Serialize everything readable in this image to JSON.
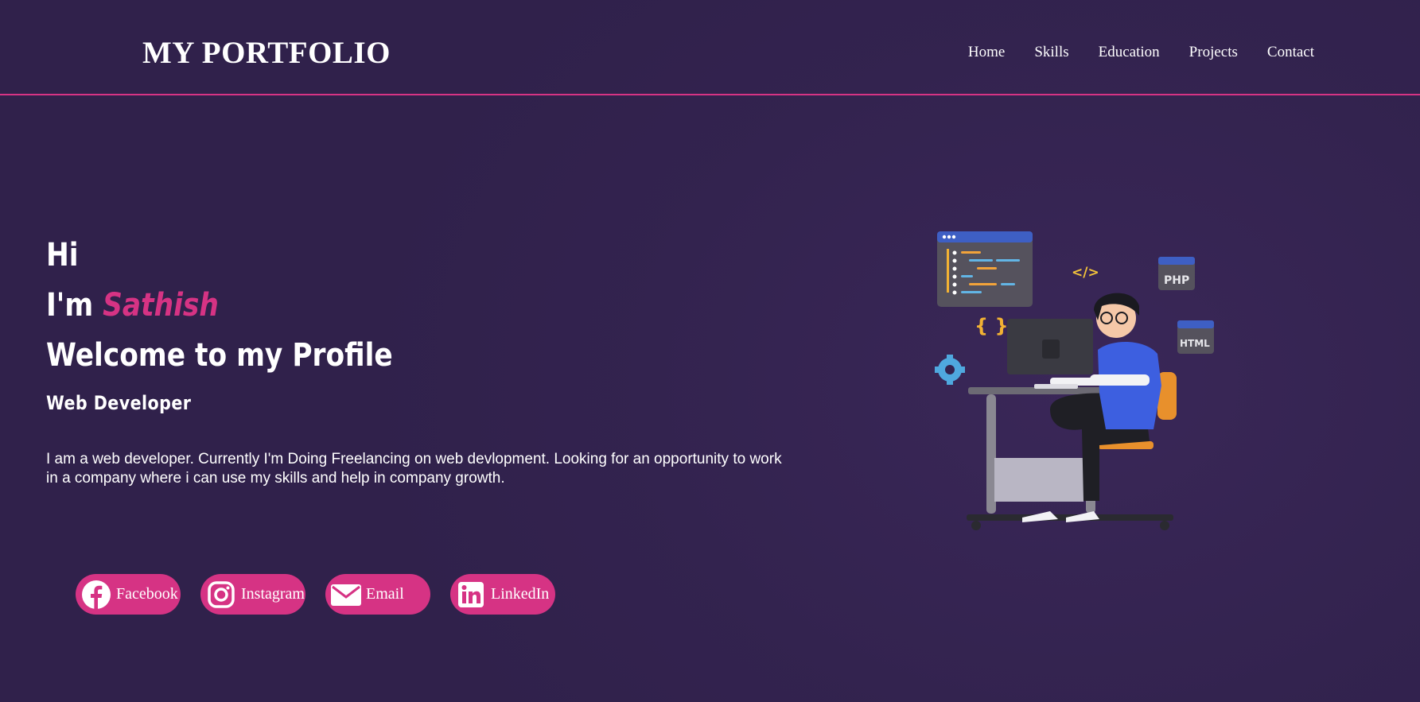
{
  "header": {
    "brand": "MY PORTFOLIO",
    "nav": [
      "Home",
      "Skills",
      "Education",
      "Projects",
      "Contact"
    ]
  },
  "hero": {
    "greeting": "Hi",
    "im_prefix": "I'm ",
    "name": "Sathish",
    "welcome": "Welcome to my Profile",
    "role": "Web Developer",
    "bio": "I am a web developer. Currently I'm Doing Freelancing on web devlopment. Looking for an opportunity to work in a company where i can use my skills and help in company growth."
  },
  "socials": [
    {
      "label": "Facebook",
      "icon": "facebook-icon"
    },
    {
      "label": "Instagram",
      "icon": "instagram-icon"
    },
    {
      "label": "Email",
      "icon": "email-icon"
    },
    {
      "label": "LinkedIn",
      "icon": "linkedin-icon"
    }
  ],
  "illustration": {
    "badges": [
      "PHP",
      "HTML"
    ],
    "code_tag": "</>",
    "braces": "{ }"
  },
  "colors": {
    "background": "#33234f",
    "accent": "#d63384",
    "text": "#ffffff"
  }
}
